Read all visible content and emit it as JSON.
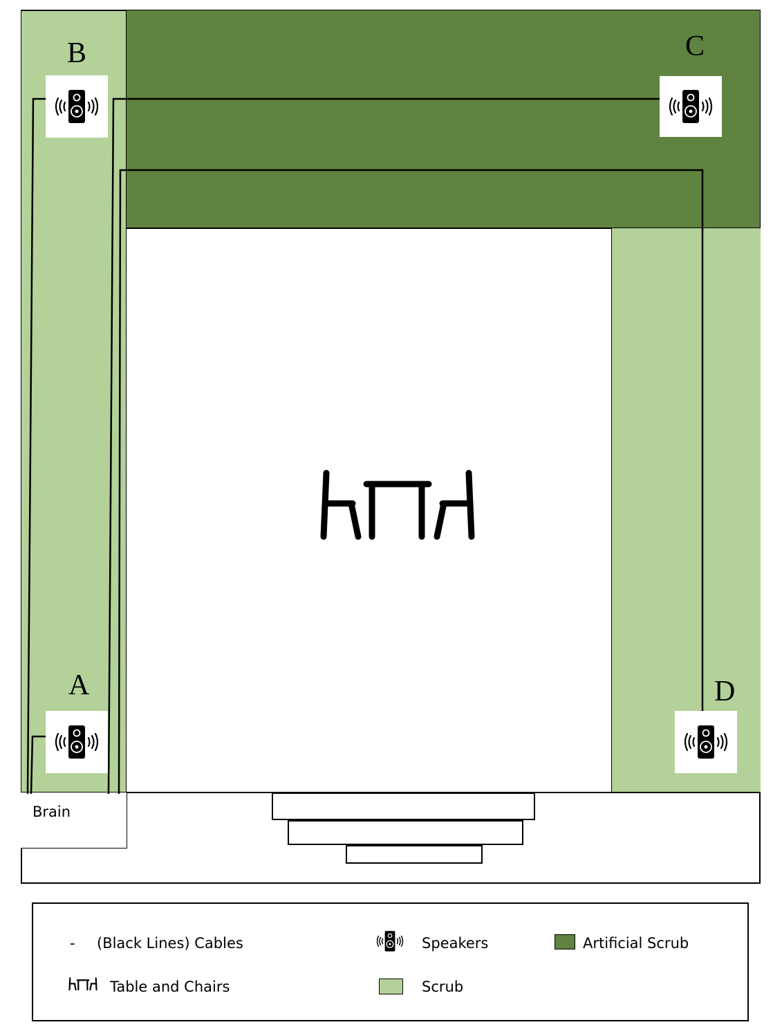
{
  "colors": {
    "scrub": "#b3d198",
    "artificial_scrub": "#5f8340",
    "cable": "#000000"
  },
  "labels": {
    "speaker_a": "A",
    "speaker_b": "B",
    "speaker_c": "C",
    "speaker_d": "D",
    "brain": "Brain"
  },
  "legend": {
    "cables_dash": "-",
    "cables": "(Black Lines) Cables",
    "table_chairs": "Table and Chairs",
    "speakers": "Speakers",
    "scrub": "Scrub",
    "artificial_scrub": "Artificial Scrub"
  },
  "icons": {
    "speaker": "speaker-icon",
    "table": "table-and-chairs-icon"
  }
}
